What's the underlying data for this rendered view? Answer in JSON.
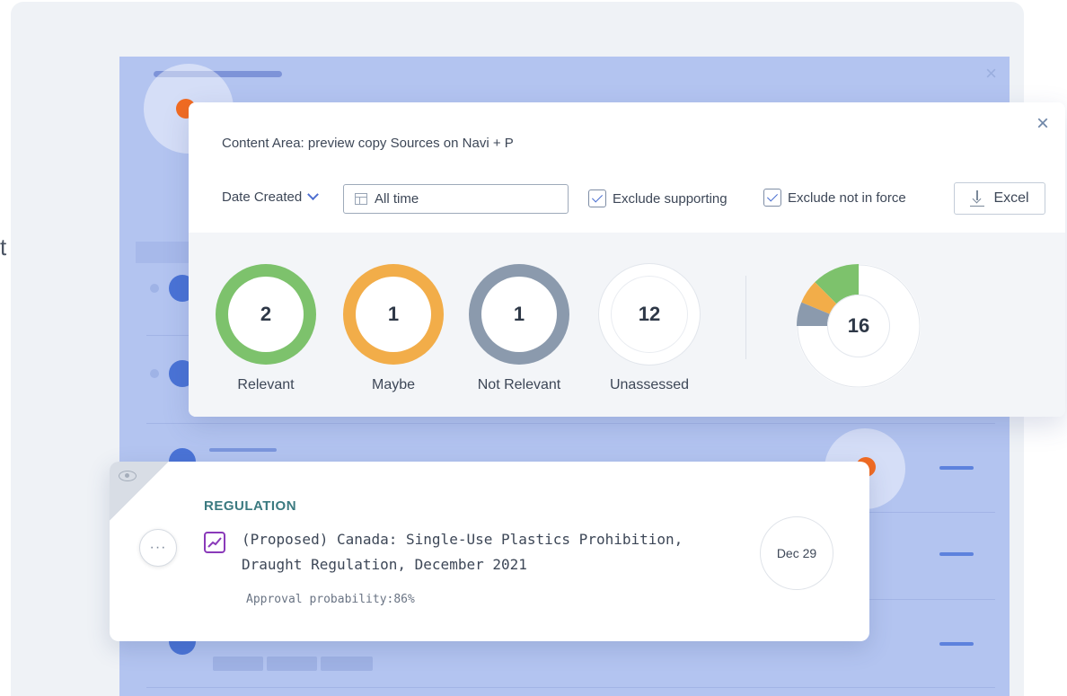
{
  "panel": {
    "title": "Content Area: preview copy Sources on Navi + P",
    "close_label": "×",
    "date_filter_label": "Date Created",
    "date_range_value": "All time",
    "exclude_supporting_label": "Exclude supporting",
    "exclude_not_in_force_label": "Exclude not in force",
    "excel_label": "Excel"
  },
  "stats": [
    {
      "label": "Relevant",
      "value": "2",
      "color": "#7dc26c"
    },
    {
      "label": "Maybe",
      "value": "1",
      "color": "#f2ad49"
    },
    {
      "label": "Not Relevant",
      "value": "1",
      "color": "#8b9aad"
    },
    {
      "label": "Unassessed",
      "value": "12",
      "color": "#ffffff"
    }
  ],
  "total": {
    "value": "16"
  },
  "regulation": {
    "type": "REGULATION",
    "title": "(Proposed) Canada: Single-Use Plastics Prohibition, Draught Regulation, December 2021",
    "approval": "Approval probability:86%",
    "date": "Dec 29",
    "more_label": "···"
  },
  "partial_text": "t"
}
